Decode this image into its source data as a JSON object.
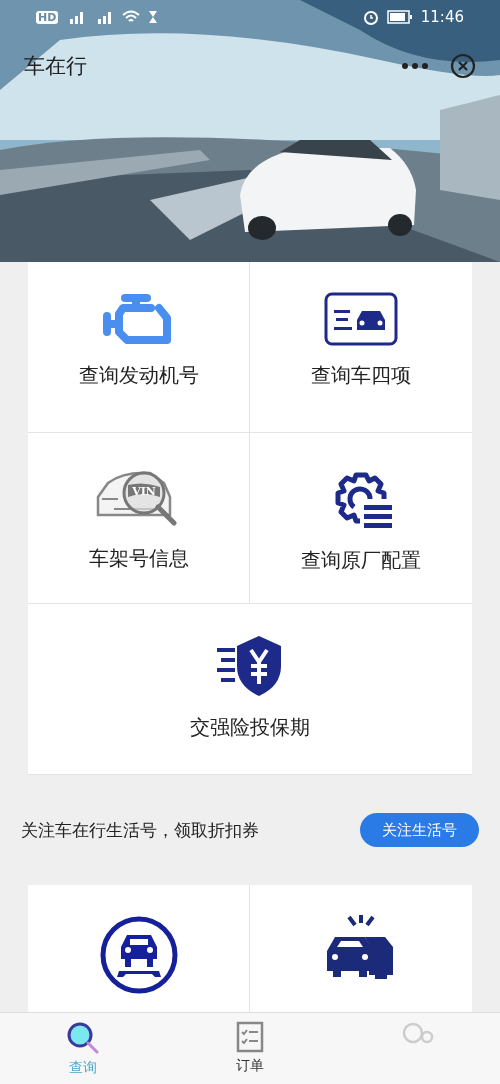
{
  "status_bar": {
    "network": "HD",
    "time": "11:46"
  },
  "header": {
    "title": "车在行"
  },
  "services": [
    {
      "label": "查询发动机号",
      "kind": "engine"
    },
    {
      "label": "查询车四项",
      "kind": "license"
    },
    {
      "label": "车架号信息",
      "kind": "vin",
      "icon_text": "VIN"
    },
    {
      "label": "查询原厂配置",
      "kind": "gear"
    },
    {
      "label": "交强险投保期",
      "kind": "insurance"
    }
  ],
  "promo": {
    "text": "关注车在行生活号，领取折扣券",
    "button": "关注生活号"
  },
  "records": [
    {
      "kind": "repair"
    },
    {
      "kind": "crash"
    }
  ],
  "tabs": [
    {
      "label": "查询",
      "kind": "search",
      "selected": true
    },
    {
      "label": "订单",
      "kind": "list",
      "selected": false
    },
    {
      "kind": "user",
      "selected": false
    }
  ]
}
